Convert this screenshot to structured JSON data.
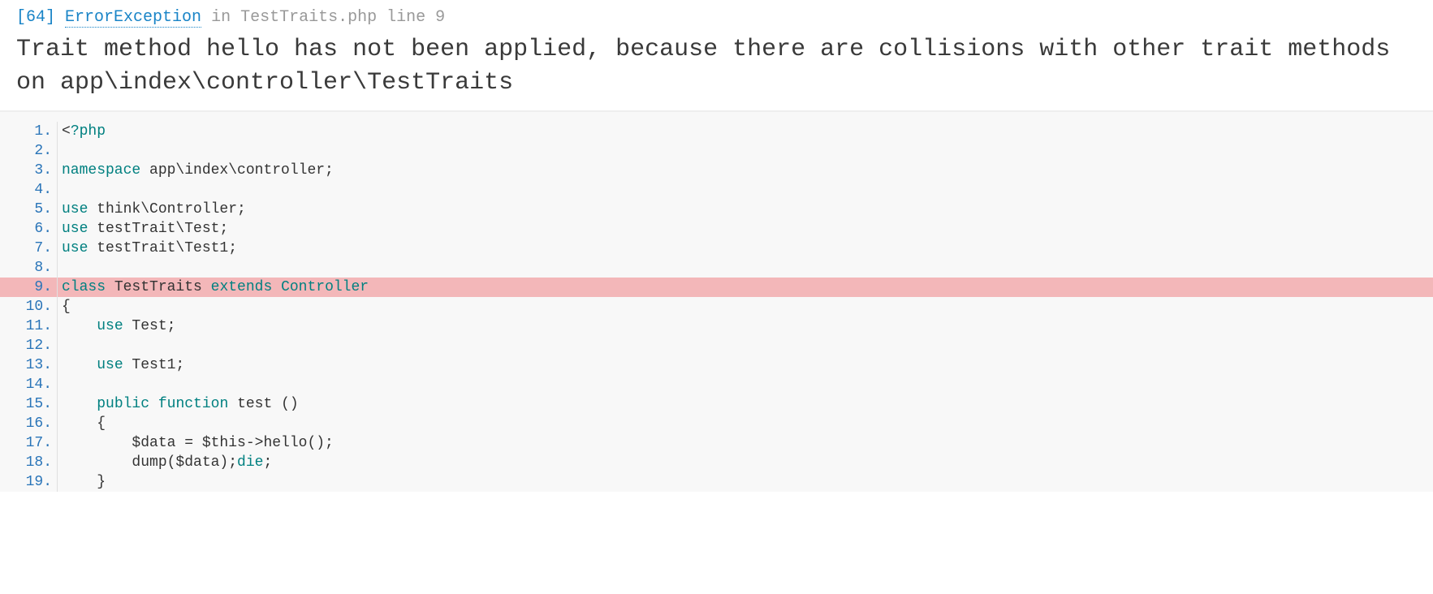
{
  "error": {
    "code": "[64]",
    "class": "ErrorException",
    "in": "in",
    "location": "TestTraits.php line 9",
    "message": "Trait method hello has not been applied, because there are collisions with other trait methods on app\\index\\controller\\TestTraits"
  },
  "code": {
    "highlight_line": 9,
    "lines": [
      {
        "n": 1,
        "raw": "<?php",
        "tokens": [
          {
            "t": "<",
            "c": "pl"
          },
          {
            "t": "?php",
            "c": "kw"
          }
        ]
      },
      {
        "n": 2,
        "raw": "",
        "tokens": []
      },
      {
        "n": 3,
        "raw": "namespace app\\index\\controller;",
        "tokens": [
          {
            "t": "namespace",
            "c": "kw"
          },
          {
            "t": " app\\index\\controller;",
            "c": "pl"
          }
        ]
      },
      {
        "n": 4,
        "raw": "",
        "tokens": []
      },
      {
        "n": 5,
        "raw": "use think\\Controller;",
        "tokens": [
          {
            "t": "use",
            "c": "kw"
          },
          {
            "t": " think\\Controller;",
            "c": "pl"
          }
        ]
      },
      {
        "n": 6,
        "raw": "use testTrait\\Test;",
        "tokens": [
          {
            "t": "use",
            "c": "kw"
          },
          {
            "t": " testTrait\\Test;",
            "c": "pl"
          }
        ]
      },
      {
        "n": 7,
        "raw": "use testTrait\\Test1;",
        "tokens": [
          {
            "t": "use",
            "c": "kw"
          },
          {
            "t": " testTrait\\Test1;",
            "c": "pl"
          }
        ]
      },
      {
        "n": 8,
        "raw": "",
        "tokens": []
      },
      {
        "n": 9,
        "raw": "class TestTraits extends Controller",
        "tokens": [
          {
            "t": "class",
            "c": "kw"
          },
          {
            "t": " TestTraits ",
            "c": "pl"
          },
          {
            "t": "extends",
            "c": "kw"
          },
          {
            "t": " Controller",
            "c": "kw"
          }
        ]
      },
      {
        "n": 10,
        "raw": "{",
        "tokens": [
          {
            "t": "{",
            "c": "pl"
          }
        ]
      },
      {
        "n": 11,
        "raw": "    use Test;",
        "tokens": [
          {
            "t": "    ",
            "c": "pl"
          },
          {
            "t": "use",
            "c": "kw"
          },
          {
            "t": " Test;",
            "c": "pl"
          }
        ]
      },
      {
        "n": 12,
        "raw": "",
        "tokens": []
      },
      {
        "n": 13,
        "raw": "    use Test1;",
        "tokens": [
          {
            "t": "    ",
            "c": "pl"
          },
          {
            "t": "use",
            "c": "kw"
          },
          {
            "t": " Test1;",
            "c": "pl"
          }
        ]
      },
      {
        "n": 14,
        "raw": "",
        "tokens": []
      },
      {
        "n": 15,
        "raw": "    public function test ()",
        "tokens": [
          {
            "t": "    ",
            "c": "pl"
          },
          {
            "t": "public",
            "c": "kw"
          },
          {
            "t": " ",
            "c": "pl"
          },
          {
            "t": "function",
            "c": "kw"
          },
          {
            "t": " test ()",
            "c": "pl"
          }
        ]
      },
      {
        "n": 16,
        "raw": "    {",
        "tokens": [
          {
            "t": "    {",
            "c": "pl"
          }
        ]
      },
      {
        "n": 17,
        "raw": "        $data = $this->hello();",
        "tokens": [
          {
            "t": "        $data = $this->hello();",
            "c": "pl"
          }
        ]
      },
      {
        "n": 18,
        "raw": "        dump($data);die;",
        "tokens": [
          {
            "t": "        dump($data);",
            "c": "pl"
          },
          {
            "t": "die",
            "c": "kw"
          },
          {
            "t": ";",
            "c": "pl"
          }
        ]
      },
      {
        "n": 19,
        "raw": "    }",
        "tokens": [
          {
            "t": "    }",
            "c": "pl"
          }
        ]
      }
    ]
  }
}
